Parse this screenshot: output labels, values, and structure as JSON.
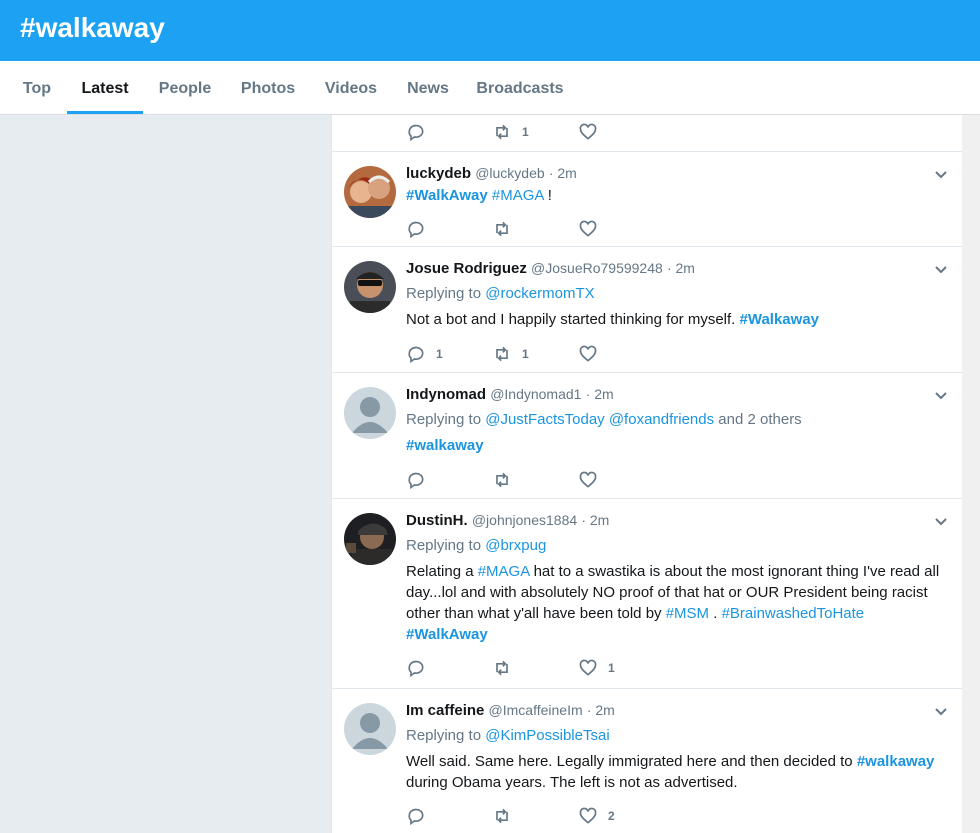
{
  "header": {
    "title": "#walkaway"
  },
  "tabs": [
    {
      "label": "Top"
    },
    {
      "label": "Latest"
    },
    {
      "label": "People"
    },
    {
      "label": "Photos"
    },
    {
      "label": "Videos"
    },
    {
      "label": "News"
    },
    {
      "label": "Broadcasts"
    }
  ],
  "colors": {
    "accent": "#1da1f2",
    "link": "#1b95e0",
    "muted": "#657786"
  },
  "tweets": [
    {
      "actions": {
        "reply": "",
        "retweet": "1",
        "like": ""
      }
    },
    {
      "name": "luckydeb",
      "handle": "@luckydeb",
      "time": "· 2m",
      "text": {
        "h1": "#WalkAway",
        "h2": "#MAGA",
        "end": " !"
      },
      "actions": {
        "reply": "",
        "retweet": "",
        "like": ""
      }
    },
    {
      "name": "Josue Rodriguez",
      "handle": "@JosueRo79599248",
      "time": "· 2m",
      "replying": {
        "prefix": "Replying to ",
        "mentions": [
          "@rockermomTX"
        ]
      },
      "text": {
        "a": "Not a bot and I happily started thinking for myself. ",
        "h1": "#Walkaway"
      },
      "actions": {
        "reply": "1",
        "retweet": "1",
        "like": ""
      }
    },
    {
      "name": "Indynomad",
      "handle": "@Indynomad1",
      "time": "· 2m",
      "replying": {
        "prefix": "Replying to ",
        "mentions": [
          "@JustFactsToday",
          "@foxandfriends"
        ],
        "suffix": " and 2 others"
      },
      "text": {
        "h1": "#walkaway"
      },
      "actions": {
        "reply": "",
        "retweet": "",
        "like": ""
      }
    },
    {
      "name": "DustinH.",
      "handle": "@johnjones1884",
      "time": "· 2m",
      "replying": {
        "prefix": "Replying to ",
        "mentions": [
          "@brxpug"
        ]
      },
      "text": {
        "a": "Relating a ",
        "h1": "#MAGA",
        "b": " hat to a swastika is about the most ignorant thing I've read all day...lol and with absolutely NO proof of that hat or OUR President being racist other than what y'all have been told by ",
        "h2": "#MSM",
        "c": " . ",
        "h3": "#BrainwashedToHate",
        "h4": "#WalkAway"
      },
      "actions": {
        "reply": "",
        "retweet": "",
        "like": "1"
      }
    },
    {
      "name": "Im caffeine",
      "handle": "@ImcaffeineIm",
      "time": "· 2m",
      "replying": {
        "prefix": "Replying to ",
        "mentions": [
          "@KimPossibleTsai"
        ]
      },
      "text": {
        "a": "Well said. Same here. Legally immigrated here and then decided to ",
        "h1": "#walkaway",
        "b": " during Obama years. The left is not as advertised."
      },
      "actions": {
        "reply": "",
        "retweet": "",
        "like": "2"
      }
    }
  ]
}
